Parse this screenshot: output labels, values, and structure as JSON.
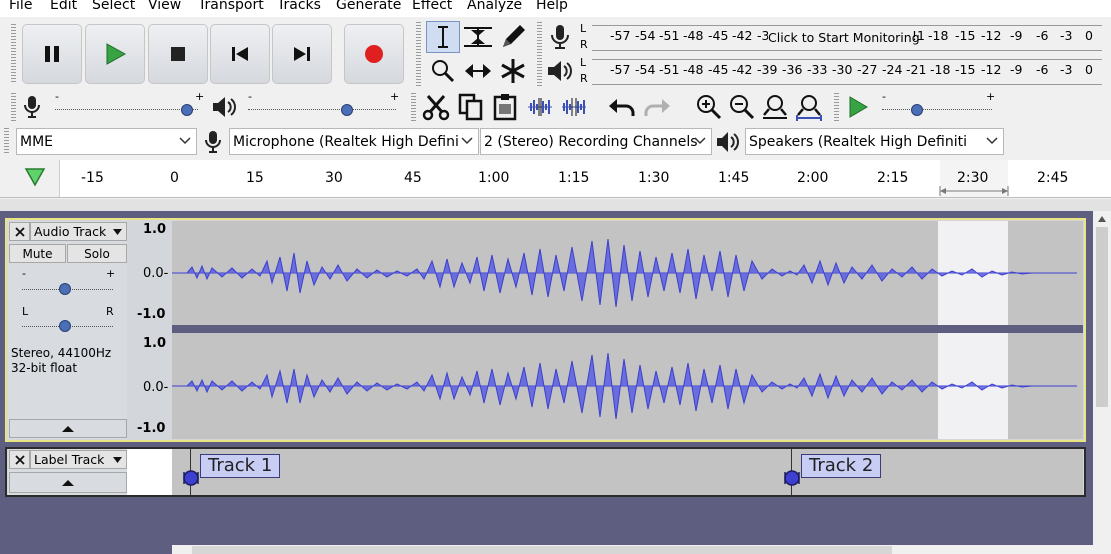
{
  "menu": [
    "File",
    "Edit",
    "Select",
    "View",
    "Transport",
    "Tracks",
    "Generate",
    "Effect",
    "Analyze",
    "Help"
  ],
  "transport": {
    "pause": "pause-icon",
    "play": "play-icon",
    "stop": "stop-icon",
    "skip_start": "skip-to-start-icon",
    "skip_end": "skip-to-end-icon",
    "record": "record-icon"
  },
  "meters": {
    "record_ticks": [
      "-57",
      "-54",
      "-51",
      "-48",
      "-45",
      "-42",
      "-3"
    ],
    "record_tail_ticks": [
      "!1",
      "-18",
      "-15",
      "-12",
      "-9",
      "-6",
      "-3",
      "0"
    ],
    "record_prompt": "Click to Start Monitoring",
    "play_ticks": [
      "-57",
      "-54",
      "-51",
      "-48",
      "-45",
      "-42",
      "-39",
      "-36",
      "-33",
      "-30",
      "-27",
      "-24",
      "-21",
      "-18",
      "-15",
      "-12",
      "-9",
      "-6",
      "-3",
      "0"
    ],
    "lr": [
      "L",
      "R"
    ]
  },
  "mixer": {
    "minus": "-",
    "plus": "+",
    "play_minus": "-",
    "play_plus": "+"
  },
  "device": {
    "host": "MME",
    "mic": "Microphone (Realtek High Defini",
    "channels": "2 (Stereo) Recording Channels",
    "speakers": "Speakers (Realtek High Definiti"
  },
  "ruler": [
    "-15",
    "0",
    "15",
    "30",
    "45",
    "1:00",
    "1:15",
    "1:30",
    "1:45",
    "2:00",
    "2:15",
    "2:30",
    "2:45"
  ],
  "audio_track": {
    "name": "Audio Track",
    "mute": "Mute",
    "solo": "Solo",
    "gain_minus": "-",
    "gain_plus": "+",
    "pan_left": "L",
    "pan_right": "R",
    "format_line1": "Stereo, 44100Hz",
    "format_line2": "32-bit float",
    "scale_top": "1.0",
    "scale_mid": "0.0-",
    "scale_bot": "-1.0",
    "scale_top2": "1.0",
    "scale_mid2": "0.0-",
    "scale_bot2": "-1.0"
  },
  "label_track": {
    "name": "Label Track",
    "labels": [
      "Track 1",
      "Track 2"
    ]
  }
}
